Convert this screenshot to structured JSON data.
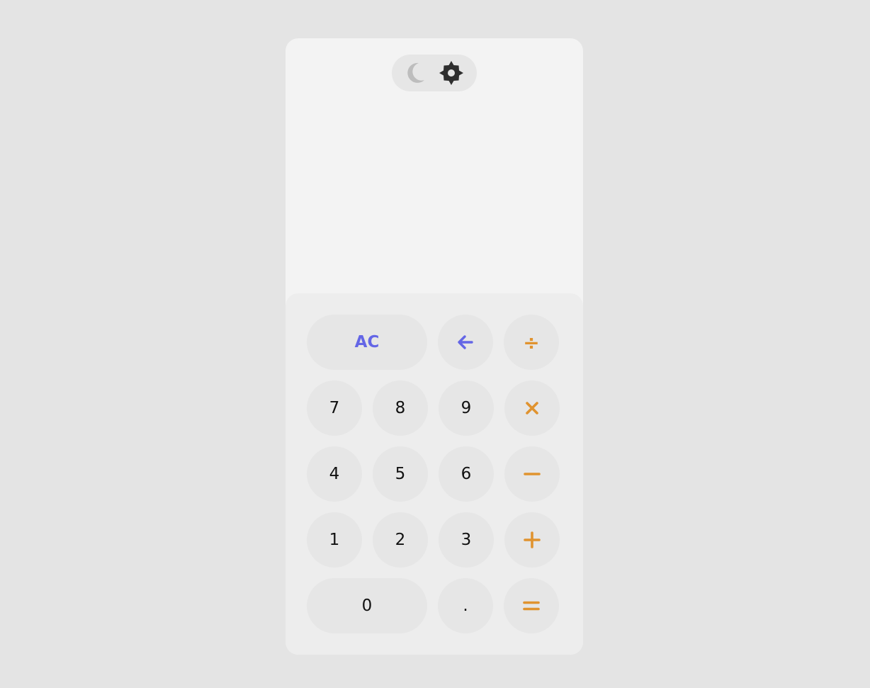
{
  "theme_toggle": {
    "moon_icon": "moon-icon",
    "sun_icon": "sun-icon"
  },
  "display": {
    "expression": "",
    "result": ""
  },
  "keypad": {
    "clear": "AC",
    "backspace_icon": "arrow-left-icon",
    "divide": "÷",
    "multiply_icon": "times-icon",
    "subtract_icon": "minus-icon",
    "add_icon": "plus-icon",
    "equals_icon": "equals-icon",
    "digits": {
      "seven": "7",
      "eight": "8",
      "nine": "9",
      "four": "4",
      "five": "5",
      "six": "6",
      "one": "1",
      "two": "2",
      "three": "3",
      "zero": "0",
      "decimal": "."
    }
  },
  "colors": {
    "background": "#e4e4e4",
    "panel": "#f3f3f3",
    "keypad": "#ededed",
    "key": "#e6e6e6",
    "accent": "#6466e6",
    "operator": "#e0932f",
    "moon": "#bdbdbd",
    "sun": "#2e2e2e"
  }
}
